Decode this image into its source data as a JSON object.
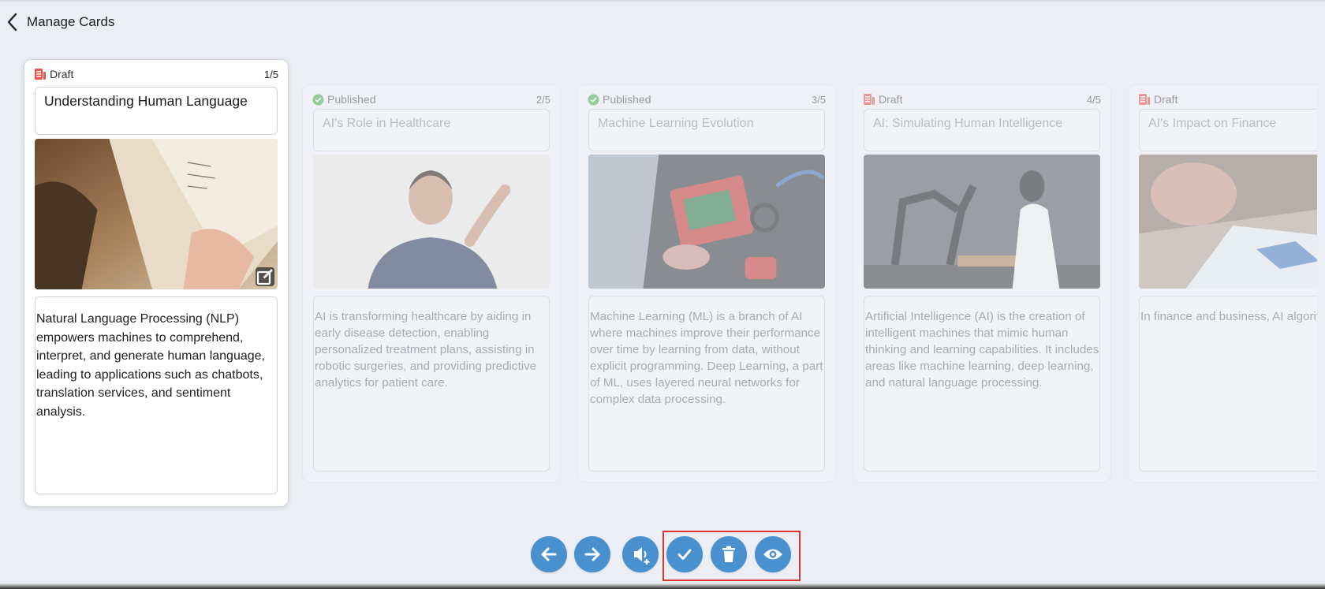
{
  "header": {
    "title": "Manage Cards"
  },
  "cards": [
    {
      "status": "Draft",
      "counter": "1/5",
      "title": "Understanding Human Language",
      "description": "Natural Language Processing (NLP) empowers machines to comprehend, interpret, and generate human language, leading to applications such as chatbots, translation services, and sentiment analysis."
    },
    {
      "status": "Published",
      "counter": "2/5",
      "title": "AI's Role in Healthcare",
      "description": "AI is transforming healthcare by aiding in early disease detection, enabling personalized treatment plans, assisting in robotic surgeries, and providing predictive analytics for patient care."
    },
    {
      "status": "Published",
      "counter": "3/5",
      "title": "Machine Learning Evolution",
      "description": "Machine Learning (ML) is a branch of AI where machines improve their performance over time by learning from data, without explicit programming. Deep Learning, a part of ML, uses layered neural networks for complex data processing."
    },
    {
      "status": "Draft",
      "counter": "4/5",
      "title": "AI: Simulating Human Intelligence",
      "description": "Artificial Intelligence (AI) is the creation of intelligent machines that mimic human thinking and learning capabilities. It includes areas like machine learning, deep learning, and natural language processing."
    },
    {
      "status": "Draft",
      "counter": "",
      "title": "AI's Impact on Finance",
      "description": "In finance and business, AI algorithms powered by neural networks, are enhancing efficiency by optimizing trading strategies, improving fraud detection systems, and automating customer service."
    }
  ],
  "toolbar": {
    "buttons": [
      "arrow-left-icon",
      "arrow-right-icon",
      "add-audio-icon",
      "check-icon",
      "trash-icon",
      "eye-icon"
    ]
  },
  "colors": {
    "accent": "#4990cf",
    "draft": "#e8554e",
    "published": "#4caf50",
    "highlight": "#e0342a"
  }
}
